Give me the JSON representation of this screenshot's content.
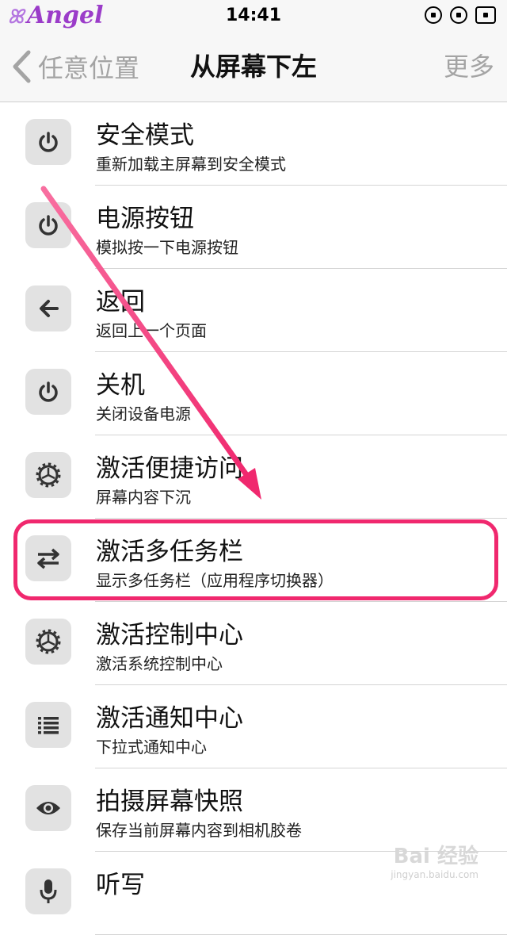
{
  "status_bar": {
    "brand": "Angel",
    "time": "14:41"
  },
  "nav": {
    "back_label": "任意位置",
    "title": "从屏幕下左",
    "more_label": "更多"
  },
  "items": [
    {
      "icon": "power-icon",
      "title": "安全模式",
      "subtitle": "重新加载主屏幕到安全模式"
    },
    {
      "icon": "power-icon",
      "title": "电源按钮",
      "subtitle": "模拟按一下电源按钮"
    },
    {
      "icon": "arrow-left-icon",
      "title": "返回",
      "subtitle": "返回上一个页面"
    },
    {
      "icon": "power-icon",
      "title": "关机",
      "subtitle": "关闭设备电源"
    },
    {
      "icon": "gear-icon",
      "title": "激活便捷访问",
      "subtitle": "屏幕内容下沉"
    },
    {
      "icon": "swap-arrows-icon",
      "title": "激活多任务栏",
      "subtitle": "显示多任务栏（应用程序切换器）",
      "highlighted": true
    },
    {
      "icon": "gear-icon",
      "title": "激活控制中心",
      "subtitle": "激活系统控制中心"
    },
    {
      "icon": "list-icon",
      "title": "激活通知中心",
      "subtitle": "下拉式通知中心"
    },
    {
      "icon": "eye-icon",
      "title": "拍摄屏幕快照",
      "subtitle": "保存当前屏幕内容到相机胶卷"
    },
    {
      "icon": "microphone-icon",
      "title": "听写",
      "subtitle": ""
    }
  ],
  "colors": {
    "highlight": "#f0286e",
    "icon_bg": "#e2e2e2",
    "nav_gray": "#a4a4a4"
  },
  "watermark": {
    "text": "Bai 经验",
    "url": "jingyan.baidu.com"
  }
}
